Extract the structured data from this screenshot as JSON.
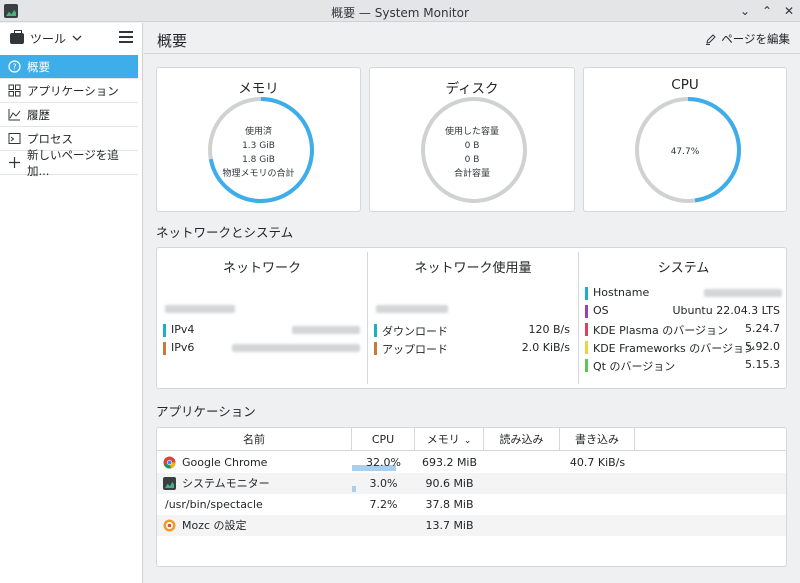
{
  "window": {
    "title": "概要 — System Monitor",
    "controls": [
      "⌄",
      "⌃",
      "✕"
    ]
  },
  "sidebar": {
    "tools_label": "ツール",
    "items": [
      {
        "label": "概要",
        "icon": "help-circle-icon",
        "active": true
      },
      {
        "label": "アプリケーション",
        "icon": "grid-icon"
      },
      {
        "label": "履歴",
        "icon": "chart-icon"
      },
      {
        "label": "プロセス",
        "icon": "terminal-icon"
      },
      {
        "label": "新しいページを追加...",
        "icon": "plus-icon"
      }
    ]
  },
  "header": {
    "title": "概要",
    "edit_label": "ページを編集"
  },
  "memory": {
    "title": "メモリ",
    "line1": "使用済",
    "line2": "1.3 GiB",
    "line3": "1.8 GiB",
    "line4": "物理メモリの合計",
    "fraction": 0.72
  },
  "disk": {
    "title": "ディスク",
    "line1": "使用した容量",
    "line2": "0 B",
    "line3": "0 B",
    "line4": "合計容量",
    "fraction": 0
  },
  "cpu": {
    "title": "CPU",
    "value": "47.7%",
    "fraction": 0.477
  },
  "netsys": {
    "section_label": "ネットワークとシステム",
    "network": {
      "title": "ネットワーク",
      "rows": [
        {
          "key": "IPv4",
          "color": "#1ab1c8"
        },
        {
          "key": "IPv6",
          "color": "#c87a3a"
        }
      ]
    },
    "usage": {
      "title": "ネットワーク使用量",
      "rows": [
        {
          "key": "ダウンロード",
          "value": "120 B/s",
          "color": "#1ab1c8"
        },
        {
          "key": "アップロード",
          "value": "2.0 KiB/s",
          "color": "#c87a3a"
        }
      ]
    },
    "system": {
      "title": "システム",
      "rows": [
        {
          "key": "Hostname",
          "value": "",
          "color": "#1ab1c8"
        },
        {
          "key": "OS",
          "value": "Ubuntu 22.04.3 LTS",
          "color": "#9b3fbf"
        },
        {
          "key": "KDE Plasma のバージョン",
          "value": "5.24.7",
          "color": "#e0405a"
        },
        {
          "key": "KDE Frameworks のバージョン",
          "value": "5.92.0",
          "color": "#e8d544"
        },
        {
          "key": "Qt のバージョン",
          "value": "5.15.3",
          "color": "#5ec45a"
        }
      ]
    }
  },
  "apps": {
    "section_label": "アプリケーション",
    "columns": [
      "名前",
      "CPU",
      "メモリ",
      "読み込み",
      "書き込み"
    ],
    "rows": [
      {
        "name": "Google Chrome",
        "icon": "chrome-icon",
        "cpu": "32.0%",
        "cpu_fraction": 0.32,
        "mem": "693.2 MiB",
        "read": "",
        "write": "40.7 KiB/s"
      },
      {
        "name": "システムモニター",
        "icon": "system-monitor-icon",
        "cpu": "3.0%",
        "cpu_fraction": 0.03,
        "mem": "90.6 MiB",
        "read": "",
        "write": ""
      },
      {
        "name": "/usr/bin/spectacle",
        "icon": "",
        "cpu": "7.2%",
        "cpu_fraction": 0,
        "mem": "37.8 MiB",
        "read": "",
        "write": ""
      },
      {
        "name": "Mozc の設定",
        "icon": "mozc-icon",
        "cpu": "",
        "cpu_fraction": 0,
        "mem": "13.7 MiB",
        "read": "",
        "write": ""
      }
    ]
  }
}
